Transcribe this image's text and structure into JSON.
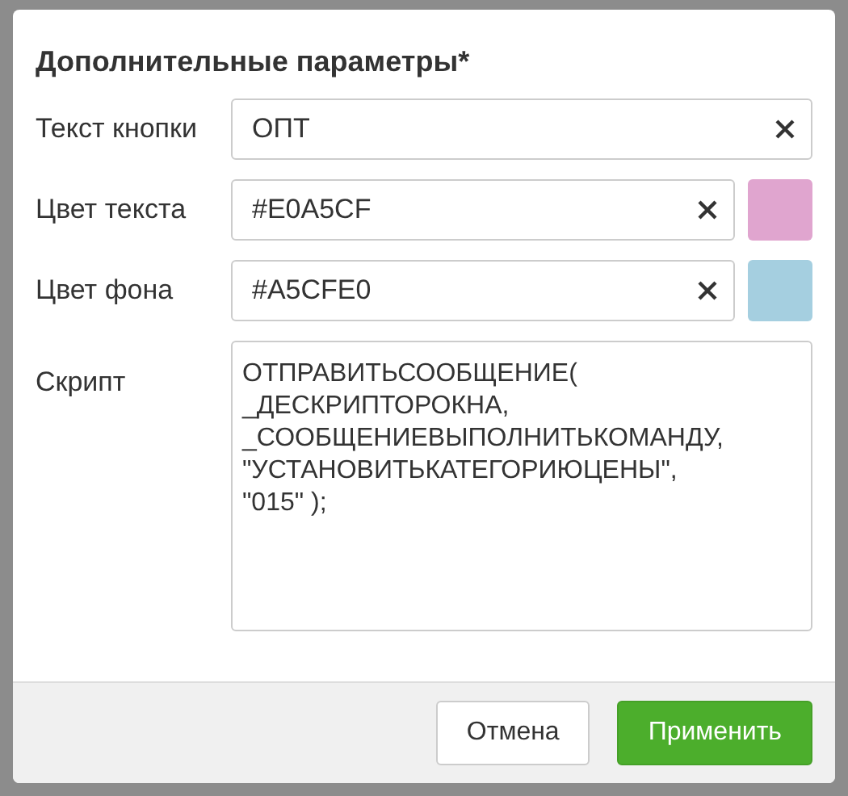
{
  "dialog": {
    "title": "Дополнительные параметры*",
    "fields": [
      {
        "kind": "text",
        "label": "Текст кнопки",
        "value": "ОПТ"
      },
      {
        "kind": "color",
        "label": "Цвет текста",
        "value": "#E0A5CF",
        "color": "#e0a5cf"
      },
      {
        "kind": "color",
        "label": "Цвет фона",
        "value": "#A5CFE0",
        "color": "#a5cfe0"
      },
      {
        "kind": "script",
        "label": "Скрипт",
        "value": "ОТПРАВИТЬСООБЩЕНИЕ(\n_ДЕСКРИПТОРОКНА,\n_СООБЩЕНИЕВЫПОЛНИТЬКОМАНДУ,\n\"УСТАНОВИТЬКАТЕГОРИЮЦЕНЫ\",\n\"015\" );"
      }
    ],
    "buttons": [
      {
        "kind": "secondary",
        "label": "Отмена"
      },
      {
        "kind": "primary",
        "label": "Применить"
      }
    ]
  }
}
